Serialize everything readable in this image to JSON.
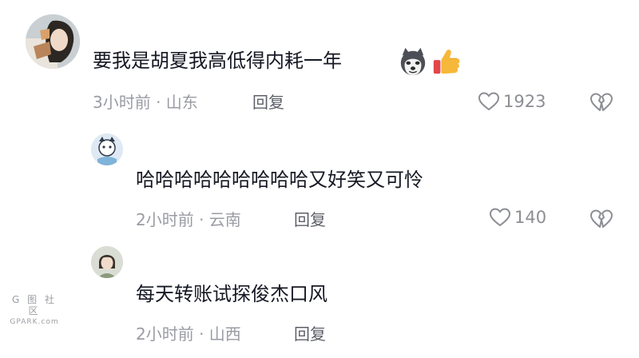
{
  "comments": [
    {
      "text": "要我是胡夏我高低得内耗一年",
      "emojis": [
        "husky-emoji",
        "thumbs-up-emoji"
      ],
      "meta": "3小时前 · 山东",
      "reply_label": "回复",
      "likes": "1923"
    },
    {
      "text": "哈哈哈哈哈哈哈哈哈又好笑又可怜",
      "meta": "2小时前 · 云南",
      "reply_label": "回复",
      "likes": "140"
    },
    {
      "text": "每天转账试探俊杰口风",
      "meta": "2小时前 · 山西",
      "reply_label": "回复"
    }
  ],
  "watermark": {
    "logo": "G 图 社 区",
    "site": "GPARK.com"
  },
  "colors": {
    "text": "#161823",
    "meta": "#9a9ca3",
    "reply": "#5e6068",
    "icon": "#8c8e94"
  }
}
